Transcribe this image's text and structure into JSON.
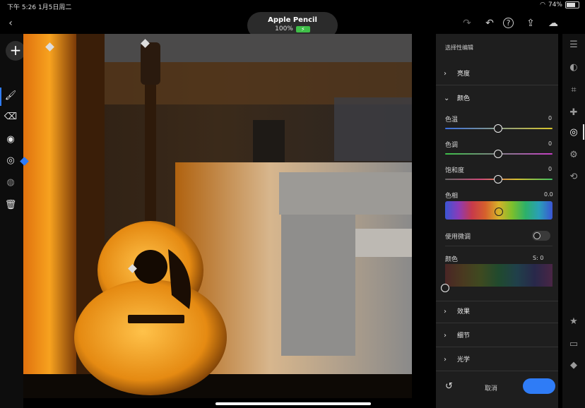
{
  "status": {
    "time": "下午 5:26",
    "date": "1月5日周二",
    "battery": "74%"
  },
  "pencil": {
    "title": "Apple Pencil",
    "percent": "100%"
  },
  "toolbar_icons": [
    "back-chevron-icon",
    "redo-icon",
    "undo-icon",
    "help-icon",
    "share-icon",
    "cloud-add-icon"
  ],
  "left_tools": [
    "brush-icon",
    "eraser-icon",
    "radial-gradient-icon",
    "linear-gradient-icon",
    "range-mask-icon",
    "trash-icon"
  ],
  "panel": {
    "header": "选择性编辑",
    "sections_top": [
      {
        "label": "亮度"
      }
    ],
    "color_section": {
      "label": "颜色",
      "temp": {
        "label": "色温",
        "value": "0"
      },
      "tint": {
        "label": "色调",
        "value": "0"
      },
      "saturation": {
        "label": "饱和度",
        "value": "0"
      },
      "hue": {
        "label": "色相",
        "value": "0.0"
      },
      "fine_tune": {
        "label": "使用微调"
      },
      "color": {
        "label": "颜色",
        "s_value": "S: 0"
      }
    },
    "sections_bottom": [
      {
        "label": "效果"
      },
      {
        "label": "细节"
      },
      {
        "label": "光学"
      }
    ],
    "bottom_label": "取消"
  },
  "rail_icons": [
    "edit-sliders-icon",
    "presets-icon",
    "crop-icon",
    "healing-icon",
    "masking-icon",
    "versions-icon",
    "history-icon",
    "star-icon",
    "comment-icon",
    "tag-icon"
  ],
  "accent": "#2f7cf6"
}
